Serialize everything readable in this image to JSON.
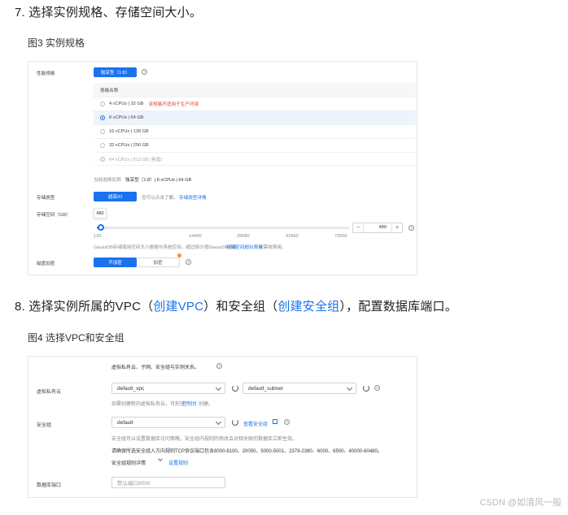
{
  "step7": {
    "title": "7. 选择实例规格、存储空间大小。"
  },
  "fig3": {
    "caption": "图3 实例规格"
  },
  "spec_panel": {
    "perf_label": "性能规格",
    "perf_btn": "独享型（1:8）",
    "col_header": "规格名称",
    "rows": [
      {
        "label": "4 vCPUs | 32 GB",
        "note": "该规格不适用于生产环境",
        "state": "normal"
      },
      {
        "label": "8 vCPUs | 64 GB",
        "note": "",
        "state": "selected"
      },
      {
        "label": "16 vCPUs | 128 GB",
        "note": "",
        "state": "normal"
      },
      {
        "label": "32 vCPUs | 256 GB",
        "note": "",
        "state": "normal"
      },
      {
        "label": "64 vCPUs | 512 GB (售罄)",
        "note": "",
        "state": "disabled"
      }
    ],
    "current_label": "当前选择实例",
    "current_value": "独享型（1:8）| 8 vCPUs | 64 GB",
    "storage_type_label": "存储类型",
    "storage_type_btn": "超高IO",
    "storage_type_hint": "您可以点击了解，",
    "storage_type_link": "存储类型详情",
    "storage_space_label": "存储空间（GB）",
    "storage_value": "480",
    "slider_fraction": 0.0168,
    "slider_ticks": [
      "120",
      "14400",
      "28680",
      "42960",
      "72000"
    ],
    "stepper_minus": "−",
    "stepper_value": "480",
    "stepper_plus": "+",
    "storage_hint_a": "GaussDB存储使用空间大小数据与系统空间，超过部分按GaussDB超额",
    "storage_hint_link": "存储空间超出费用",
    "storage_hint_b": "按需收费用。",
    "encrypt_label": "磁盘加密",
    "encrypt_on": "不加密",
    "encrypt_off": "加密"
  },
  "step8": {
    "prefix": "8. 选择实例所属的VPC（",
    "link1": "创建VPC",
    "mid": "）和安全组（",
    "link2": "创建安全组",
    "suffix": "），配置数据库端口。"
  },
  "fig4": {
    "caption": "图4 选择VPC和安全组"
  },
  "vpc_panel": {
    "top_text": "虚拟私有云、子网、安全组与实例关系。",
    "vpc_label": "虚拟私有云",
    "vpc_value": "default_vpc",
    "subnet_value": "default_subnet",
    "vpc_hint_a": "如需创建新的虚拟私有云，可前往",
    "vpc_hint_link": "控制台",
    "vpc_hint_b": "创建。",
    "sg_label": "安全组",
    "sg_value": "default",
    "sg_link": "查看安全组",
    "sg_hint": "安全组可以设置数据库访问策略，安全组内规则的修改会对相关联的数据库立即生效。",
    "sg_rule": "请确保所选安全组入方向规则TCP协议端口包含8000-8100、20050、5000-5001、2379-2380、6000、6500、40000-60480。",
    "sg_detail": "安全组规则详情",
    "sg_set": "设置规则",
    "port_label": "数据库端口",
    "port_placeholder": "默认端口8000"
  },
  "watermark": "CSDN @如清风一般"
}
